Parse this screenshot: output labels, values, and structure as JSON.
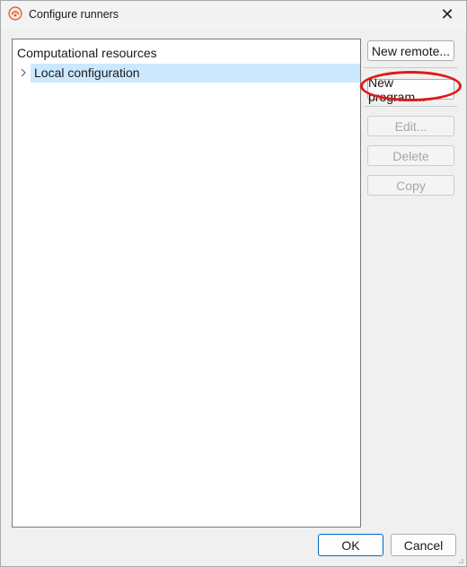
{
  "window": {
    "title": "Configure runners",
    "close_symbol": "✕",
    "app_icon": "app-logo-icon"
  },
  "tree": {
    "root_label": "Computational resources",
    "items": [
      {
        "label": "Local configuration",
        "expander": "›",
        "selected": true
      }
    ]
  },
  "side_buttons": {
    "new_remote": "New remote...",
    "new_program": "New program...",
    "edit": "Edit...",
    "delete": "Delete",
    "copy": "Copy"
  },
  "footer": {
    "ok": "OK",
    "cancel": "Cancel"
  },
  "colors": {
    "selection": "#cce8ff",
    "annotation_ring": "#e01a1a",
    "default_button_border": "#0067c0"
  }
}
